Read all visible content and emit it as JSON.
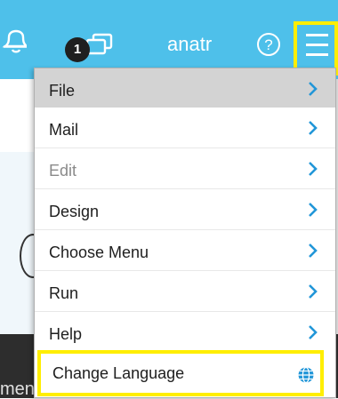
{
  "topbar": {
    "badge_count": "1",
    "username": "anatr",
    "icons": [
      "bell-icon",
      "windows-icon",
      "help-icon",
      "hamburger-icon"
    ]
  },
  "background": {
    "partial_text": "ments"
  },
  "menu": {
    "items": [
      {
        "label": "File",
        "state": "hovered",
        "icon": "chevron-right-icon"
      },
      {
        "label": "Mail",
        "state": "normal",
        "icon": "chevron-right-icon"
      },
      {
        "label": "Edit",
        "state": "disabled",
        "icon": "chevron-right-icon"
      },
      {
        "label": "Design",
        "state": "normal",
        "icon": "chevron-right-icon"
      },
      {
        "label": "Choose Menu",
        "state": "normal",
        "icon": "chevron-right-icon"
      },
      {
        "label": "Run",
        "state": "normal",
        "icon": "chevron-right-icon"
      },
      {
        "label": "Help",
        "state": "normal",
        "icon": "chevron-right-icon"
      },
      {
        "label": "Change Language",
        "state": "highlighted",
        "icon": "globe-icon"
      }
    ]
  },
  "colors": {
    "header": "#4ec0ea",
    "highlight": "#ffee00",
    "accent": "#2196d8",
    "hover": "#d3d3d3"
  }
}
